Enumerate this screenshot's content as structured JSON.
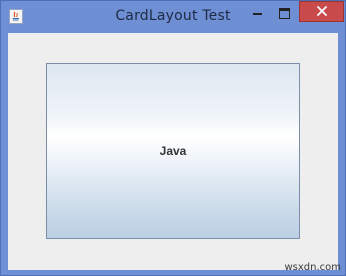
{
  "window": {
    "title": "CardLayout Test"
  },
  "titlebar": {
    "app_icon": "java-icon",
    "minimize_icon": "minimize-icon",
    "maximize_icon": "maximize-icon",
    "close_icon": "close-icon"
  },
  "card": {
    "label": "Java"
  },
  "watermark": {
    "text": "wsxdn.com"
  },
  "colors": {
    "frame": "#6e8fd3",
    "close_button": "#c94a4a",
    "content_background": "#eeeeee",
    "card_border": "#7a8ea9"
  }
}
